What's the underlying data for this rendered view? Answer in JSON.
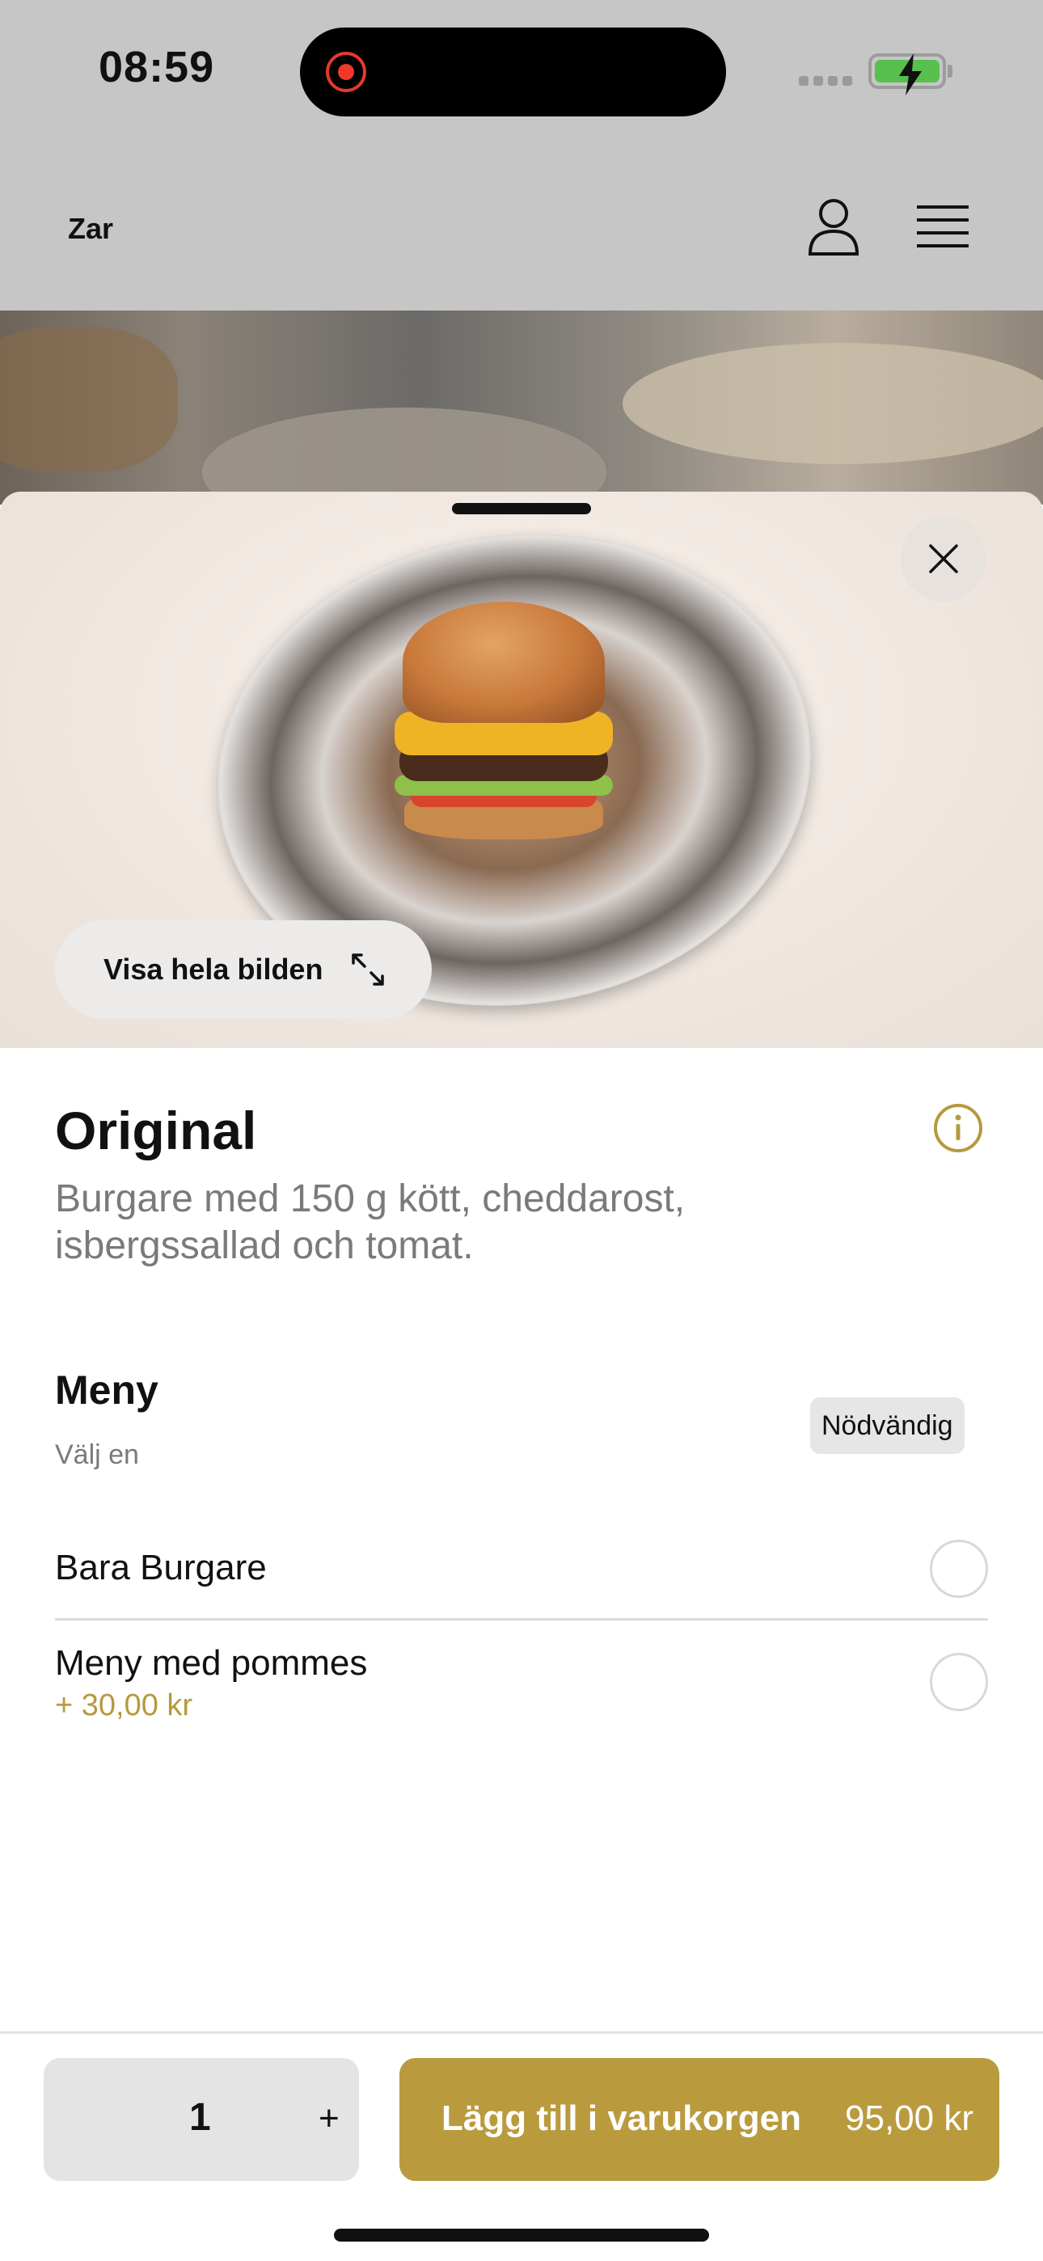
{
  "status_bar": {
    "time": "08:59"
  },
  "header": {
    "brand": "Zar",
    "icons": [
      "person-icon",
      "menu-icon"
    ]
  },
  "hero": {
    "view_full_label": "Visa hela bilden",
    "icons": [
      "close-icon",
      "expand-icon"
    ]
  },
  "product": {
    "title": "Original",
    "description": "Burgare med 150 g kött, cheddarost, isbergssallad och tomat."
  },
  "menu_section": {
    "title": "Meny",
    "subtitle": "Välj en",
    "required_label": "Nödvändig",
    "options": [
      {
        "label": "Bara Burgare",
        "price": ""
      },
      {
        "label": "Meny med pommes",
        "price": "+ 30,00 kr"
      }
    ]
  },
  "cart": {
    "quantity": "1",
    "plus_label": "+",
    "add_label": "Lägg till i varukorgen",
    "total": "95,00 kr"
  },
  "colors": {
    "accent": "#b99b3e",
    "price": "#b59a3d",
    "battery": "#57c04e",
    "record": "#f0382a"
  }
}
